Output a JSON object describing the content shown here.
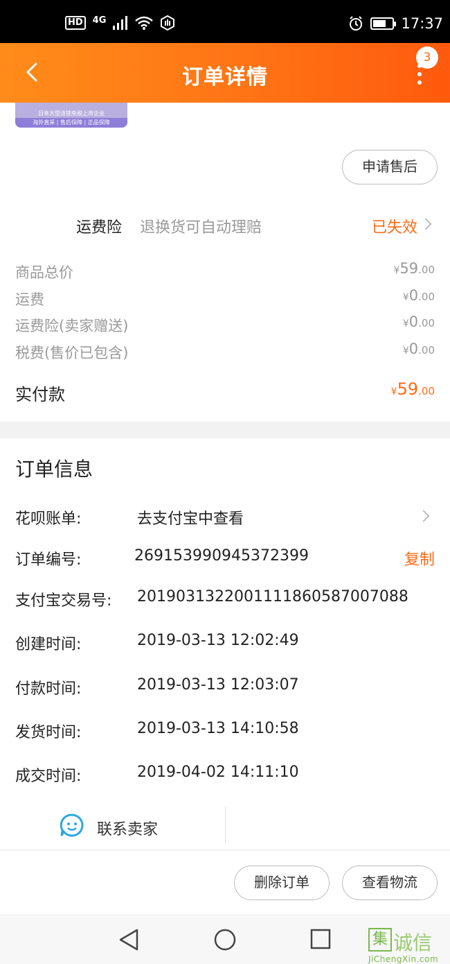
{
  "status_bar": {
    "hd": "HD",
    "network": "4G",
    "time": "17:37"
  },
  "header": {
    "title": "订单详情",
    "badge_count": "3"
  },
  "product_image": {
    "line1": "日本大型连锁免税上市企业",
    "line2": "海外直采 | 售后保障 | 正品保障"
  },
  "after_sale_button": "申请售后",
  "insurance": {
    "label": "运费险",
    "description": "退换货可自动理赔",
    "status": "已失效"
  },
  "fees": [
    {
      "label": "商品总价",
      "currency": "¥",
      "int": "59",
      "dec": ".00"
    },
    {
      "label": "运费",
      "currency": "¥",
      "int": "0",
      "dec": ".00"
    },
    {
      "label": "运费险(卖家赠送)",
      "currency": "¥",
      "int": "0",
      "dec": ".00"
    },
    {
      "label": "税费(售价已包含)",
      "currency": "¥",
      "int": "0",
      "dec": ".00"
    }
  ],
  "paid": {
    "label": "实付款",
    "currency": "¥",
    "int": "59",
    "dec": ".00"
  },
  "order_info": {
    "title": "订单信息",
    "huabei_label": "花呗账单:",
    "huabei_value": "去支付宝中查看",
    "order_no_label": "订单编号:",
    "order_no_value": "2691539909453723​99",
    "copy_label": "复制",
    "alipay_label": "支付宝交易号:",
    "alipay_value": "2019031322001111860587007088",
    "created_label": "创建时间:",
    "created_value": "2019-03-13 12:02:49",
    "paid_time_label": "付款时间:",
    "paid_time_value": "2019-03-13 12:03:07",
    "shipped_label": "发货时间:",
    "shipped_value": "2019-03-13 14:10:58",
    "closed_label": "成交时间:",
    "closed_value": "2019-04-02 14:11:10"
  },
  "contact_seller": "联系卖家",
  "bottom_actions": {
    "delete": "删除订单",
    "logistics": "查看物流"
  },
  "watermark": {
    "box": "集",
    "text": "诚信",
    "url": "JiChengXin.com"
  },
  "colors": {
    "accent": "#ff6a13",
    "header_start": "#ff8c1a",
    "header_end": "#ff5a0d",
    "icon_blue": "#2aa8e0"
  },
  "battery_level": 0.7
}
